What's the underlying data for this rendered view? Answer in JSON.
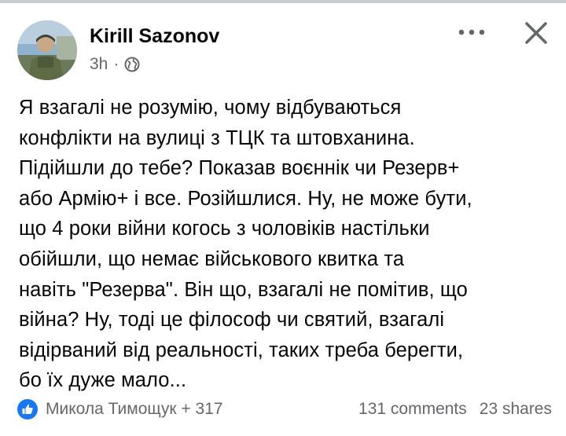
{
  "post": {
    "author": "Kirill Sazonov",
    "time": "3h",
    "separator": "·",
    "lines": [
      "Я взагалі не розумію, чому відбуваються",
      "конфлікти на вулиці з ТЦК та штовханина.",
      "Підійшли до тебе? Показав воєннік чи Резерв+",
      "або Армію+ і все. Розійшлися. Ну, не може бути,",
      "що 4 роки війни когось з чоловіків настільки",
      "обійшли, що немає військового квитка та",
      "навіть \"Резерва\". Він що, взагалі не помітив, що",
      "війна? Ну, тоді це філософ чи святий, взагалі",
      "відірваний від реальності, таких треба берегти,",
      "бо їх дуже мало..."
    ]
  },
  "footer": {
    "reactors": "Микола Тимощук + 317",
    "comments": "131 comments",
    "shares": "23 shares"
  },
  "icons": {
    "globe": "globe-icon",
    "more": "more-horizontal-icon",
    "close": "close-icon",
    "like": "like-icon"
  },
  "colors": {
    "accent": "#1877f2",
    "secondary_text": "#65676b",
    "primary_text": "#050505"
  }
}
